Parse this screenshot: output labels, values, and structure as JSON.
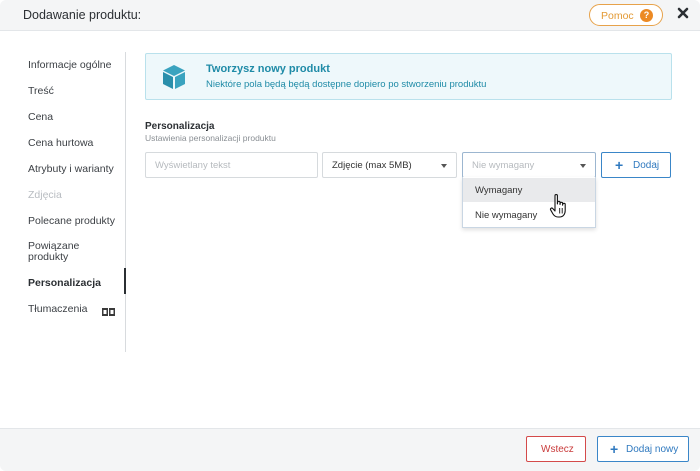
{
  "header": {
    "title": "Dodawanie produktu:",
    "help_label": "Pomoc",
    "help_icon_char": "?"
  },
  "sidebar": {
    "items": [
      {
        "label": "Informacje ogólne"
      },
      {
        "label": "Treść"
      },
      {
        "label": "Cena"
      },
      {
        "label": "Cena hurtowa"
      },
      {
        "label": "Atrybuty i warianty"
      },
      {
        "label": "Zdjęcia",
        "state": "disabled"
      },
      {
        "label": "Polecane produkty"
      },
      {
        "label": "Powiązane produkty"
      },
      {
        "label": "Personalizacja",
        "state": "active"
      },
      {
        "label": "Tłumaczenia"
      }
    ]
  },
  "info": {
    "title": "Tworzysz nowy produkt",
    "text": "Niektóre pola będą będą dostępne dopiero po stworzeniu produktu"
  },
  "personalization": {
    "title": "Personalizacja",
    "subtitle": "Ustawienia personalizacji produktu",
    "text_input_placeholder": "Wyświetlany tekst",
    "type_select_value": "Zdjęcie (max 5MB)",
    "required_select_value": "Nie wymagany",
    "add_label": "Dodaj",
    "dropdown_options": [
      "Wymagany",
      "Nie wymagany"
    ]
  },
  "footer": {
    "back_label": "Wstecz",
    "add_new_label": "Dodaj nowy"
  },
  "colors": {
    "accent_blue": "#2f79bf",
    "danger_red": "#c93b3b",
    "help_orange": "#ec8a24",
    "info_teal": "#1f8ba7"
  }
}
